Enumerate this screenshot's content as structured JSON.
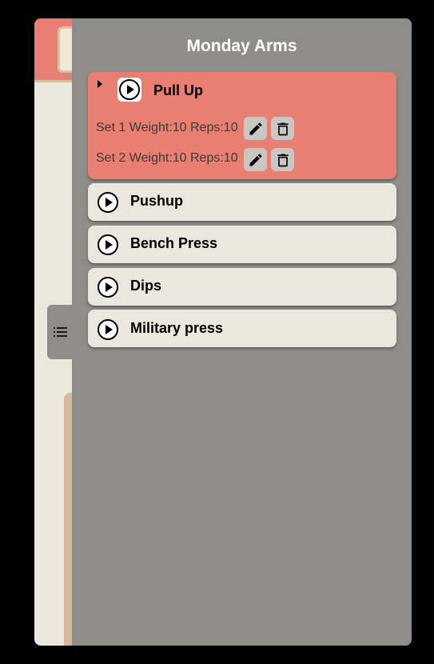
{
  "drawer": {
    "title": "Monday Arms",
    "toggle_icon": "list-icon"
  },
  "exercises": [
    {
      "name": "Pull Up",
      "expanded": true,
      "sets": [
        {
          "label": "Set 1 Weight:10 Reps:10"
        },
        {
          "label": "Set 2 Weight:10 Reps:10"
        }
      ]
    },
    {
      "name": "Pushup"
    },
    {
      "name": "Bench Press"
    },
    {
      "name": "Dips"
    },
    {
      "name": "Military press"
    }
  ],
  "colors": {
    "active_exercise": "#e97f72",
    "exercise_bg": "#ebe7dd",
    "drawer_bg": "#8e8d89"
  }
}
